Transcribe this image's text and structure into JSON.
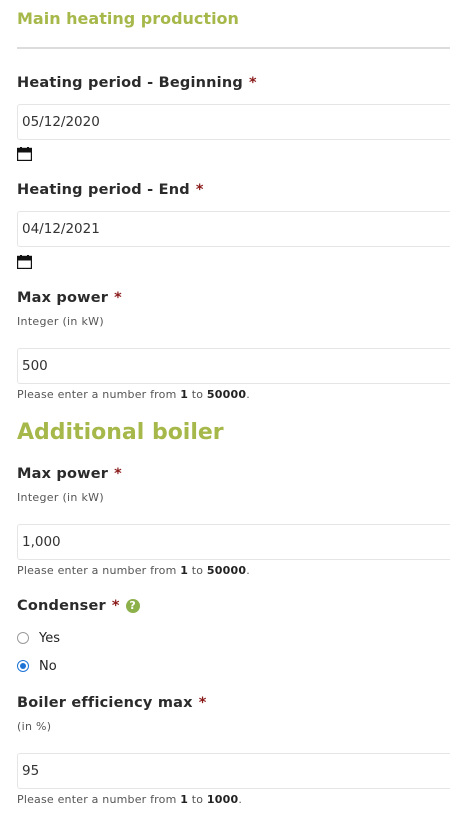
{
  "sections": {
    "main_title": "Main heating production",
    "additional_title": "Additional boiler"
  },
  "required_mark": "*",
  "heating_begin": {
    "label": "Heating period - Beginning",
    "value": "05/12/2020",
    "icon": "calendar-icon"
  },
  "heating_end": {
    "label": "Heating period - End",
    "value": "04/12/2021",
    "icon": "calendar-icon"
  },
  "main_max_power": {
    "label": "Max power",
    "hint": "Integer (in kW)",
    "value": "500",
    "help_prefix": "Please enter a number from",
    "help_min": "1",
    "help_to": "to",
    "help_max": "50000",
    "help_end": "."
  },
  "boiler_max_power": {
    "label": "Max power",
    "hint": "Integer (in kW)",
    "value": "1,000",
    "help_prefix": "Please enter a number from",
    "help_min": "1",
    "help_to": "to",
    "help_max": "50000",
    "help_end": "."
  },
  "condenser": {
    "label": "Condenser",
    "help_icon": "?",
    "options": [
      {
        "label": "Yes",
        "checked": false
      },
      {
        "label": "No",
        "checked": true
      }
    ]
  },
  "boiler_efficiency": {
    "label": "Boiler efficiency max",
    "hint": "(in %)",
    "value": "95",
    "help_prefix": "Please enter a number from",
    "help_min": "1",
    "help_to": "to",
    "help_max": "1000",
    "help_end": "."
  },
  "colors": {
    "accent_green": "#a6b84a",
    "required_red": "#8b1a1a",
    "radio_blue": "#1e74d6"
  }
}
